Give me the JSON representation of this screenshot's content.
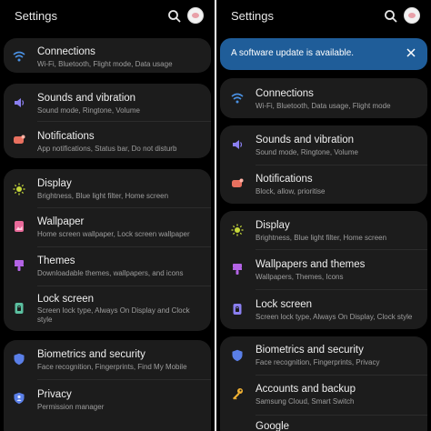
{
  "left": {
    "title": "Settings",
    "items": [
      {
        "title": "Connections",
        "subtitle": "Wi-Fi, Bluetooth, Flight mode, Data usage"
      },
      {
        "title": "Sounds and vibration",
        "subtitle": "Sound mode, Ringtone, Volume"
      },
      {
        "title": "Notifications",
        "subtitle": "App notifications, Status bar, Do not disturb"
      },
      {
        "title": "Display",
        "subtitle": "Brightness, Blue light filter, Home screen"
      },
      {
        "title": "Wallpaper",
        "subtitle": "Home screen wallpaper, Lock screen wallpaper"
      },
      {
        "title": "Themes",
        "subtitle": "Downloadable themes, wallpapers, and icons"
      },
      {
        "title": "Lock screen",
        "subtitle": "Screen lock type, Always On Display and Clock style"
      },
      {
        "title": "Biometrics and security",
        "subtitle": "Face recognition, Fingerprints, Find My Mobile"
      },
      {
        "title": "Privacy",
        "subtitle": "Permission manager"
      }
    ]
  },
  "right": {
    "title": "Settings",
    "banner": "A software update is available.",
    "items": [
      {
        "title": "Connections",
        "subtitle": "Wi-Fi, Bluetooth, Data usage, Flight mode"
      },
      {
        "title": "Sounds and vibration",
        "subtitle": "Sound mode, Ringtone, Volume"
      },
      {
        "title": "Notifications",
        "subtitle": "Block, allow, prioritise"
      },
      {
        "title": "Display",
        "subtitle": "Brightness, Blue light filter, Home screen"
      },
      {
        "title": "Wallpapers and themes",
        "subtitle": "Wallpapers, Themes, Icons"
      },
      {
        "title": "Lock screen",
        "subtitle": "Screen lock type, Always On Display, Clock style"
      },
      {
        "title": "Biometrics and security",
        "subtitle": "Face recognition, Fingerprints, Privacy"
      },
      {
        "title": "Accounts and backup",
        "subtitle": "Samsung Cloud, Smart Switch"
      },
      {
        "title": "Google"
      }
    ]
  },
  "colors": {
    "wifi": "#4a90e2",
    "sound": "#8a7ff0",
    "notif": "#e8705f",
    "display": "#c7d93a",
    "wallpaper": "#e96a9a",
    "themes": "#b464e6",
    "lock": "#5bc0a0",
    "lock_right": "#8a7ff0",
    "biometrics": "#5a7fe8",
    "privacy": "#5a7fe8",
    "accounts": "#f2b233",
    "banner": "#1f5d99"
  },
  "icons": [
    "search-icon",
    "wifi-icon",
    "speaker-icon",
    "notification-icon",
    "brightness-icon",
    "wallpaper-icon",
    "brush-icon",
    "lock-icon",
    "shield-icon",
    "privacy-shield-icon",
    "key-icon",
    "close-icon"
  ]
}
